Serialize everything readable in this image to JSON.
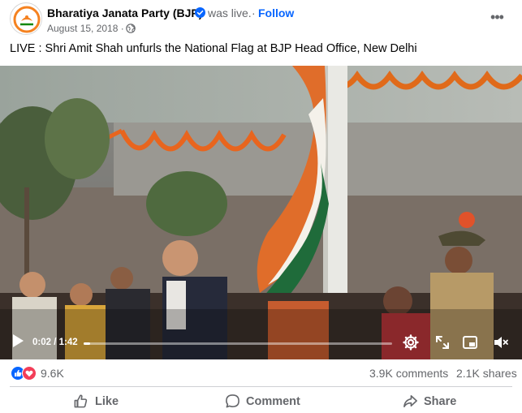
{
  "post": {
    "page_name": "Bharatiya Janata Party (BJP)",
    "status_text": "was live.",
    "separator": "·",
    "follow_label": "Follow",
    "date": "August 15, 2018 ·",
    "more_label": "•••",
    "caption": "LIVE : Shri Amit Shah unfurls the National Flag at BJP Head Office, New Delhi"
  },
  "video": {
    "time": "0:02 / 1:42",
    "progress": 0.02
  },
  "stats": {
    "reactions_count": "9.6K",
    "comments": "3.9K comments",
    "shares": "2.1K shares"
  },
  "actions": {
    "like": "Like",
    "comment": "Comment",
    "share": "Share"
  },
  "colors": {
    "accent": "#0866ff",
    "secondary_text": "#65676b",
    "like_blue": "#0866ff",
    "love_red": "#f33e58"
  },
  "icons": {
    "verified": "verified-badge-icon",
    "globe": "globe-icon",
    "play": "play-icon",
    "settings": "settings-gear-icon",
    "fullscreen": "expand-icon",
    "pip": "picture-in-picture-icon",
    "mute": "volume-muted-icon",
    "like": "thumbs-up-icon",
    "comment": "speech-bubble-icon",
    "share": "share-arrow-icon"
  }
}
